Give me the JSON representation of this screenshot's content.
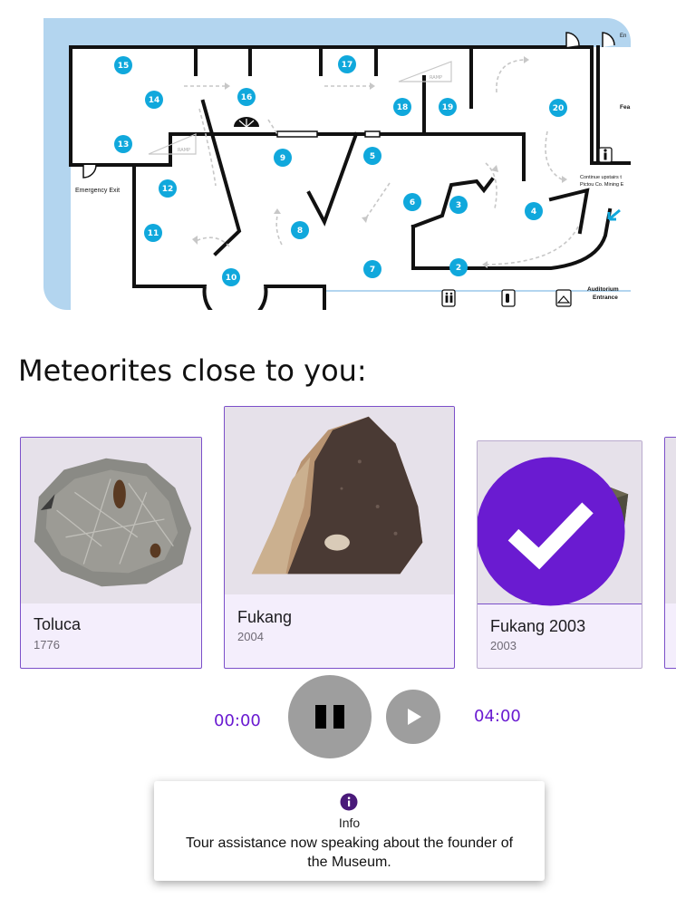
{
  "map": {
    "rooms": [
      "15",
      "14",
      "13",
      "12",
      "11",
      "10",
      "16",
      "17",
      "18",
      "19",
      "20",
      "9",
      "8",
      "7",
      "6",
      "5",
      "4",
      "3",
      "2"
    ],
    "labels": {
      "emergency_exit": "Emergency Exit",
      "ramp1": "RAMP",
      "ramp2": "RAMP",
      "continue_line1": "Continue upstairs t",
      "continue_line2": "Pictou Co. Mining E",
      "auditorium_line1": "Auditorium",
      "auditorium_line2": "Entrance",
      "fea": "Fea",
      "en": "En"
    },
    "colors": {
      "background": "#b3d5ef",
      "marker": "#10a8dc",
      "walls": "#111111"
    }
  },
  "section_title": "Meteorites close to you:",
  "cards": [
    {
      "title": "Toluca",
      "year": "1776",
      "selected": false
    },
    {
      "title": "Fukang",
      "year": "2004",
      "selected": false
    },
    {
      "title": "Fukang 2003",
      "year": "2003",
      "selected": true
    }
  ],
  "player": {
    "current_time": "00:00",
    "total_time": "04:00",
    "pause_icon": "pause-icon",
    "play_icon": "play-icon"
  },
  "toast": {
    "icon": "info-icon",
    "label": "Info",
    "message": "Tour assistance now speaking about the founder of the Museum."
  },
  "colors": {
    "accent": "#6a1bd1",
    "card_bg": "#f4eefc",
    "button_gray": "#9e9e9e"
  }
}
